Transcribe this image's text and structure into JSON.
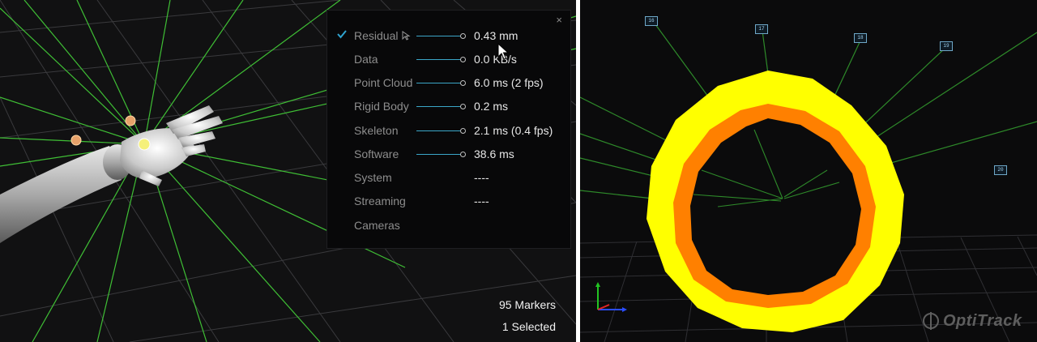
{
  "left_view": {
    "panel": {
      "close_label": "×",
      "rows": [
        {
          "label": "Residual",
          "value": "0.43 mm",
          "checked": true
        },
        {
          "label": "Data",
          "value": "0.0 KB/s"
        },
        {
          "label": "Point Cloud",
          "value": "6.0 ms (2 fps)"
        },
        {
          "label": "Rigid Body",
          "value": "0.2 ms"
        },
        {
          "label": "Skeleton",
          "value": "2.1 ms (0.4 fps)"
        },
        {
          "label": "Software",
          "value": "38.6 ms"
        },
        {
          "label": "System",
          "value": "----"
        },
        {
          "label": "Streaming",
          "value": "----"
        },
        {
          "label": "Cameras",
          "value": ""
        }
      ]
    },
    "status": {
      "markers": "95 Markers",
      "selected": "1 Selected"
    }
  },
  "right_view": {
    "camera_labels": [
      "16",
      "17",
      "18",
      "19",
      "20"
    ],
    "logo_text": "OptiTrack"
  },
  "colors": {
    "ray_green": "#3fbf35",
    "ring_yellow": "#ffff00",
    "ring_orange": "#ff8000",
    "bar_cyan": "#3ba6c8",
    "check_cyan": "#2fa4d0"
  }
}
